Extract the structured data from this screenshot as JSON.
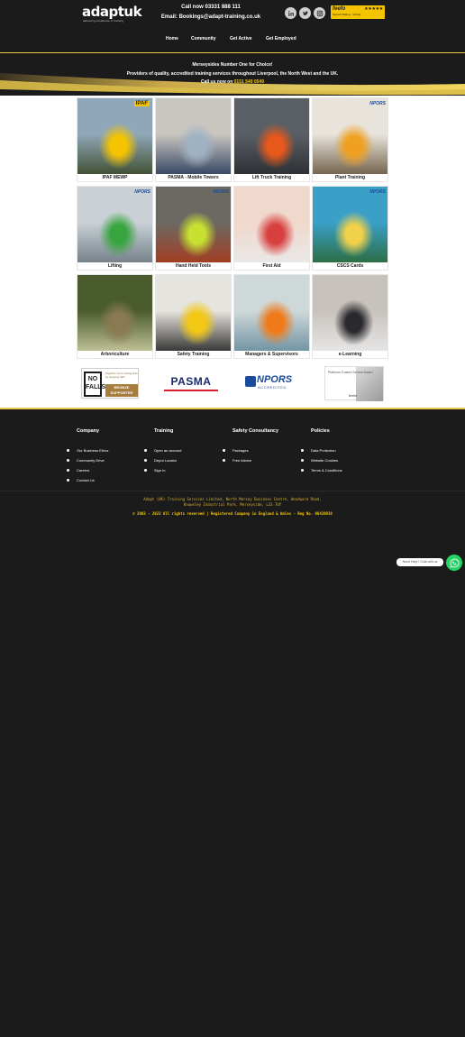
{
  "header": {
    "logo": {
      "brand": "adapt",
      "suffix": "uk",
      "tagline": "delivering excellence in training"
    },
    "call_line": "Call now 03331 888 111",
    "email_line": "Email: Bookings@adapt-training.co.uk",
    "socials": [
      "linkedin-icon",
      "twitter-icon",
      "instagram-icon"
    ],
    "feefo": {
      "brand": "feefo",
      "stars": "★★★★★",
      "sub": "Service Rating   ·   ratings"
    }
  },
  "nav": [
    "Home",
    "Community",
    "Get Active",
    "Get Employed"
  ],
  "banner": {
    "line1": "Merseysides Number One for Choice!",
    "line2": "Providers of quality, accredited training services throughout Liverpool, the North West and the UK.",
    "line3_prefix": "Call us now on ",
    "phone": "0151 549 0549"
  },
  "tiles": [
    {
      "label": "IPAF MEWP",
      "badge": "IPAF",
      "badge_type": "ipaf",
      "colors": [
        "#8fa7b8",
        "#f5c400",
        "#3b4a2a"
      ]
    },
    {
      "label": "PASMA - Mobile Towers",
      "badge": "",
      "badge_type": "",
      "colors": [
        "#c9c6c0",
        "#9fb2c3",
        "#2c3e5c"
      ]
    },
    {
      "label": "Lift Truck Training",
      "badge": "",
      "badge_type": "",
      "colors": [
        "#5a5f66",
        "#e8581a",
        "#2a2d31"
      ]
    },
    {
      "label": "Plant Training",
      "badge": "NPORS",
      "badge_type": "npors",
      "colors": [
        "#e8e4dc",
        "#f0a020",
        "#6b5a40"
      ]
    },
    {
      "label": "Lifting",
      "badge": "NPORS",
      "badge_type": "npors",
      "colors": [
        "#c9d1d6",
        "#38a540",
        "#6f7b84"
      ]
    },
    {
      "label": "Hand Held Tools",
      "badge": "NPORS",
      "badge_type": "npors",
      "colors": [
        "#6b6a62",
        "#c8e030",
        "#a83a1e"
      ]
    },
    {
      "label": "First Aid",
      "badge": "",
      "badge_type": "",
      "colors": [
        "#f0d8cc",
        "#d84040",
        "#e9e9e9"
      ]
    },
    {
      "label": "CSCS Cards",
      "badge": "NPORS",
      "badge_type": "npors",
      "colors": [
        "#3aa0c8",
        "#f2d14a",
        "#2c6a3a"
      ]
    },
    {
      "label": "Arboriculture",
      "badge": "",
      "badge_type": "",
      "colors": [
        "#4a5c2e",
        "#8a7a52",
        "#c9c8a0"
      ]
    },
    {
      "label": "Safety Training",
      "badge": "",
      "badge_type": "",
      "colors": [
        "#e6e4de",
        "#f2c814",
        "#2a2a2a"
      ]
    },
    {
      "label": "Managers & Supervisors",
      "badge": "",
      "badge_type": "",
      "colors": [
        "#cfd8d8",
        "#f07a1a",
        "#6a8fa0"
      ]
    },
    {
      "label": "e-Learning",
      "badge": "",
      "badge_type": "",
      "colors": [
        "#c8c2bc",
        "#2a2a2e",
        "#e8e8e8"
      ]
    }
  ],
  "accreditations": {
    "nofalls": {
      "big": "NO FALLS",
      "tagline": "Together we're saving lives by stopping falls",
      "level": "BRONZE SUPPORTER"
    },
    "pasma": "PASMA",
    "npors": {
      "name": "NPORS",
      "sub": "ACCREDITED"
    },
    "feefo_award": {
      "title": "Platinum Trusted Service Award",
      "brand": "feefo"
    }
  },
  "footer": {
    "columns": [
      {
        "title": "Company",
        "items": [
          "Our Business Ethos",
          "Community Drive",
          "Careers",
          "Contact Us"
        ]
      },
      {
        "title": "Training",
        "items": [
          "Open an account",
          "Depot Locator",
          "Sign In"
        ]
      },
      {
        "title": "Safety Consultancy",
        "items": [
          "Packages",
          "Free Advice"
        ]
      },
      {
        "title": "Policies",
        "items": [
          "Data Protection",
          "Website Cookies",
          "Terms & Conditions"
        ]
      }
    ],
    "legal_line1": "Adapt (UK) Training Services Limited, North Mersey Business Centre, Woodward Road,",
    "legal_line2": "Knowsley Industrial Park, Merseyside, L33 7UY",
    "legal_line3": "© 2003 - 2023 All rights reserved  |  Registered Company in England & Wales - Reg No. 06420938"
  },
  "whatsapp": {
    "bubble": "Need Help? Chat with us",
    "icon": "whatsapp-icon",
    "color": "#25d366"
  },
  "colors": {
    "bg": "#1c1b1c",
    "accent": "#f5c400",
    "gold": "#e9c84a"
  }
}
